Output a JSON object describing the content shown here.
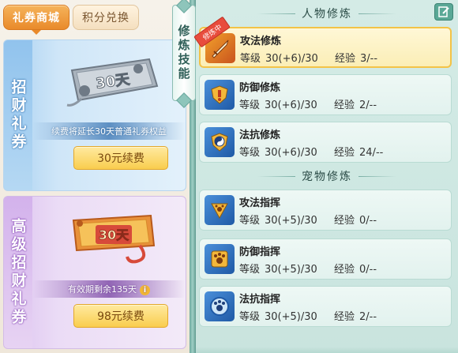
{
  "tabs": [
    {
      "label": "礼券商城",
      "active": true
    },
    {
      "label": "积分兑换",
      "active": false
    }
  ],
  "left_cards": [
    {
      "vertical_label": "招财礼券",
      "coupon_text": "30天",
      "note": "续费将延长30天普通礼券权益",
      "button": "30元续费"
    },
    {
      "vertical_label": "高级招财礼券",
      "coupon_text": "30天",
      "note": "有效期剩余135天",
      "button": "98元续费"
    }
  ],
  "side_tab": "修炼技能",
  "sections": [
    {
      "title": "人物修炼"
    },
    {
      "title": "宠物修炼"
    }
  ],
  "labels": {
    "level": "等级",
    "exp": "经验",
    "badge": "修炼中"
  },
  "skills": [
    {
      "name": "攻法修炼",
      "level": "30(+6)/30",
      "exp": "3/--",
      "icon": "sword-icon",
      "selected": true
    },
    {
      "name": "防御修炼",
      "level": "30(+6)/30",
      "exp": "2/--",
      "icon": "shield-icon",
      "selected": false
    },
    {
      "name": "法抗修炼",
      "level": "30(+6)/30",
      "exp": "24/--",
      "icon": "taiji-shield-icon",
      "selected": false
    },
    {
      "name": "攻法指挥",
      "level": "30(+5)/30",
      "exp": "0/--",
      "icon": "paw-attack-icon",
      "selected": false
    },
    {
      "name": "防御指挥",
      "level": "30(+5)/30",
      "exp": "0/--",
      "icon": "paw-defense-icon",
      "selected": false
    },
    {
      "name": "法抗指挥",
      "level": "30(+5)/30",
      "exp": "2/--",
      "icon": "paw-resist-icon",
      "selected": false
    }
  ],
  "colors": {
    "accent_orange": "#e98a2b",
    "button_gold": "#f9cd4e",
    "panel_teal": "#c9e4de",
    "selected_yellow": "#fbeeb6"
  }
}
